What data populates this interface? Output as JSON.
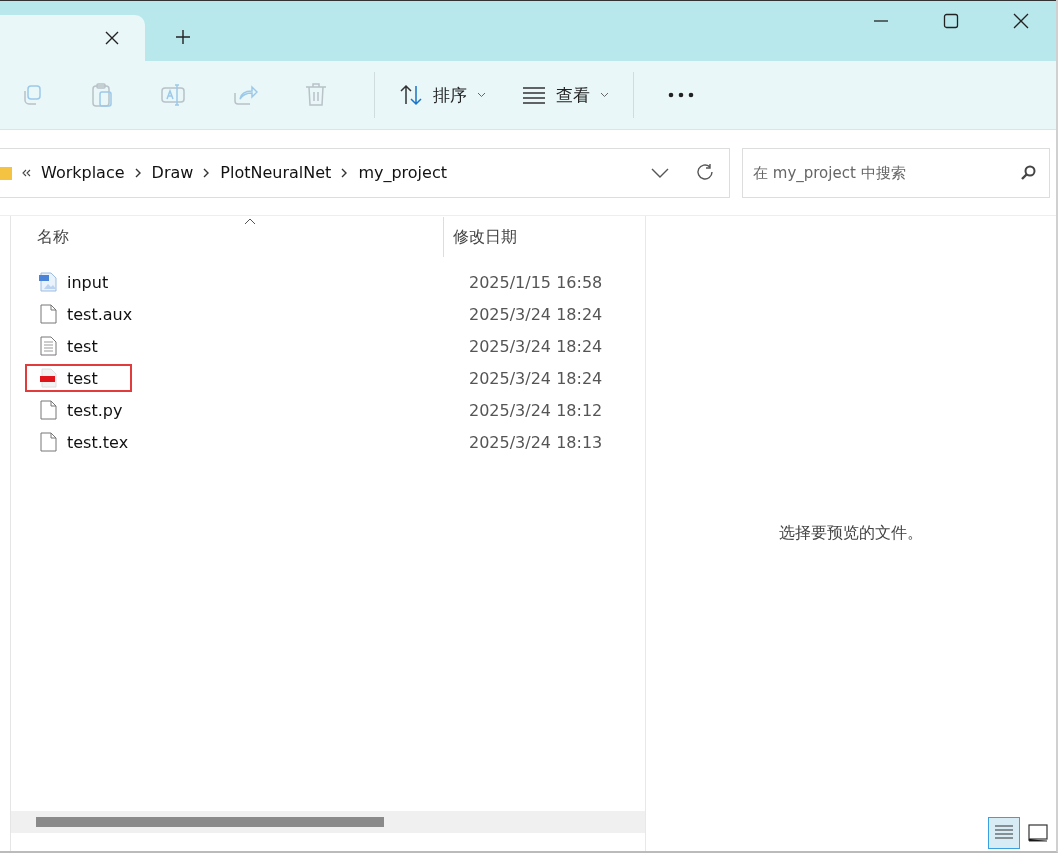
{
  "toolbar": {
    "sort": {
      "label": "排序"
    },
    "view": {
      "label": "查看"
    }
  },
  "address": {
    "path": [
      "Workplace",
      "Draw",
      "PlotNeuralNet",
      "my_project"
    ]
  },
  "search": {
    "placeholder": "在 my_project 中搜索"
  },
  "columns": [
    "名称",
    "修改日期"
  ],
  "files": [
    {
      "name": "input",
      "kind": "image",
      "date": "2025/1/15 16:58",
      "highlighted": false
    },
    {
      "name": "test.aux",
      "kind": "blank",
      "date": "2025/3/24 18:24",
      "highlighted": false
    },
    {
      "name": "test",
      "kind": "text",
      "date": "2025/3/24 18:24",
      "highlighted": false
    },
    {
      "name": "test",
      "kind": "pdf",
      "date": "2025/3/24 18:24",
      "highlighted": true
    },
    {
      "name": "test.py",
      "kind": "blank",
      "date": "2025/3/24 18:12",
      "highlighted": false
    },
    {
      "name": "test.tex",
      "kind": "blank",
      "date": "2025/3/24 18:13",
      "highlighted": false
    }
  ],
  "preview": {
    "message": "选择要预览的文件。"
  },
  "view_buttons": [
    {
      "kind": "details",
      "selected": true
    },
    {
      "kind": "preview",
      "selected": false
    }
  ]
}
